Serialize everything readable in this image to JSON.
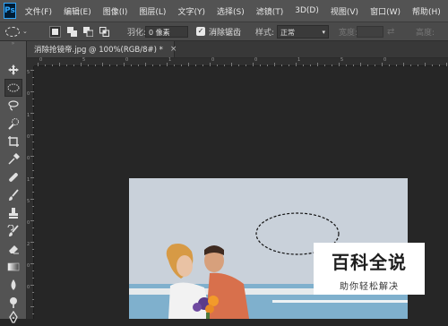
{
  "app": {
    "logo_text": "Ps"
  },
  "menu": [
    "文件(F)",
    "编辑(E)",
    "图像(I)",
    "图层(L)",
    "文字(Y)",
    "选择(S)",
    "滤镜(T)",
    "3D(D)",
    "视图(V)",
    "窗口(W)",
    "帮助(H)"
  ],
  "options": {
    "tool_preset_icon": "elliptical-marquee-icon",
    "selection_modes": [
      "new-selection",
      "add-to-selection",
      "subtract-from-selection",
      "intersect-with-selection"
    ],
    "feather_label": "羽化:",
    "feather_value": "0 像素",
    "antialias_checked": true,
    "antialias_label": "消除锯齿",
    "style_label": "样式:",
    "style_value": "正常",
    "width_label": "宽度:",
    "height_label": "高度:"
  },
  "tools": [
    "move-icon",
    "elliptical-marquee-icon",
    "lasso-icon",
    "quick-selection-icon",
    "crop-icon",
    "eyedropper-icon",
    "healing-brush-icon",
    "brush-icon",
    "clone-stamp-icon",
    "history-brush-icon",
    "eraser-icon",
    "gradient-icon",
    "blur-icon",
    "dodge-icon",
    "pen-icon"
  ],
  "document": {
    "tab_title": "消除抢镜帝.jpg @ 100%(RGB/8#) *",
    "close_symbol": "×"
  },
  "rulers": {
    "h_numbers": [
      "0",
      "5",
      "0",
      "1",
      "0",
      "0",
      "1",
      "5",
      "0"
    ],
    "v_numbers": [
      "5",
      "0",
      "1",
      "0",
      "0",
      "1",
      "5",
      "0",
      "2",
      "0",
      "0"
    ]
  },
  "watermark": {
    "title": "百科全说",
    "subtitle": "助你轻松解决"
  }
}
